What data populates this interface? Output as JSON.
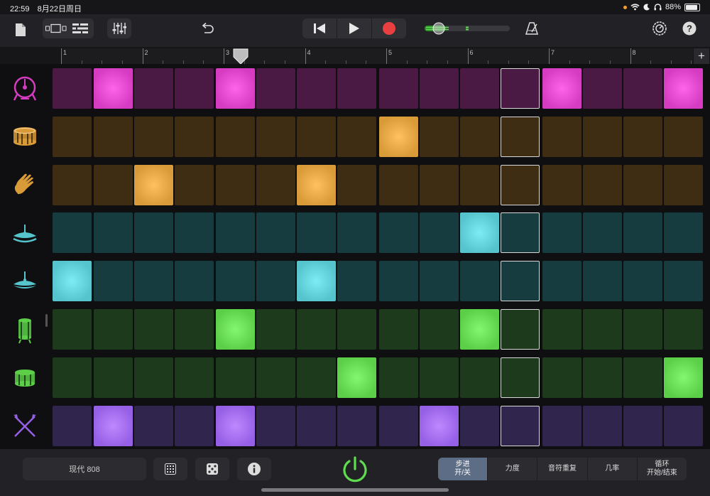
{
  "status_bar": {
    "time": "22:59",
    "date": "8月22日周日",
    "battery": "88%",
    "battery_level": 0.88
  },
  "toolbar": {
    "icons": [
      "document-icon",
      "view-toggle-icon",
      "list-view-icon",
      "mixer-icon",
      "undo-icon",
      "rewind-icon",
      "play-icon",
      "record-icon",
      "master-volume-icon",
      "metronome-icon",
      "settings-icon",
      "help-icon"
    ]
  },
  "ruler": {
    "bars": [
      "1",
      "2",
      "3",
      "4",
      "5",
      "6",
      "7",
      "8"
    ],
    "playhead_bar": 3
  },
  "playhead_step": 12,
  "rows": [
    {
      "name": "kick-drum",
      "icon": "kick-drum-icon",
      "color": "#d63cc2",
      "dim": "#4a1a45",
      "on": [
        2,
        5,
        13,
        16
      ]
    },
    {
      "name": "snare-drum",
      "icon": "snare-drum-icon",
      "color": "#d99a38",
      "dim": "#3e2d13",
      "on": [
        9
      ]
    },
    {
      "name": "hand-clap",
      "icon": "hand-clap-icon",
      "color": "#d99a38",
      "dim": "#3e2d13",
      "on": [
        3,
        7
      ]
    },
    {
      "name": "open-hi-hat",
      "icon": "open-hi-hat-icon",
      "color": "#56c4cc",
      "dim": "#163c40",
      "on": [
        11
      ]
    },
    {
      "name": "closed-hi-hat",
      "icon": "closed-hi-hat-icon",
      "color": "#56c4cc",
      "dim": "#163c40",
      "on": [
        1,
        7
      ]
    },
    {
      "name": "tom-high",
      "icon": "tom-high-icon",
      "color": "#5ccf48",
      "dim": "#1e3a1c",
      "on": [
        5,
        11
      ]
    },
    {
      "name": "tom-low",
      "icon": "tom-low-icon",
      "color": "#5ccf48",
      "dim": "#1e3a1c",
      "on": [
        8,
        16
      ]
    },
    {
      "name": "sticks",
      "icon": "crossed-sticks-icon",
      "color": "#9660e6",
      "dim": "#30254d",
      "on": [
        2,
        5,
        10
      ]
    }
  ],
  "bottom": {
    "kit_name": "现代 808",
    "buttons": [
      "grid-icon",
      "dice-icon",
      "info-icon",
      "power-icon"
    ],
    "modes": [
      {
        "label": "步进\n开/关",
        "active": true
      },
      {
        "label": "力度",
        "active": false
      },
      {
        "label": "音符重复",
        "active": false
      },
      {
        "label": "几率",
        "active": false
      },
      {
        "label": "循环\n开始/结束",
        "active": false
      }
    ]
  }
}
